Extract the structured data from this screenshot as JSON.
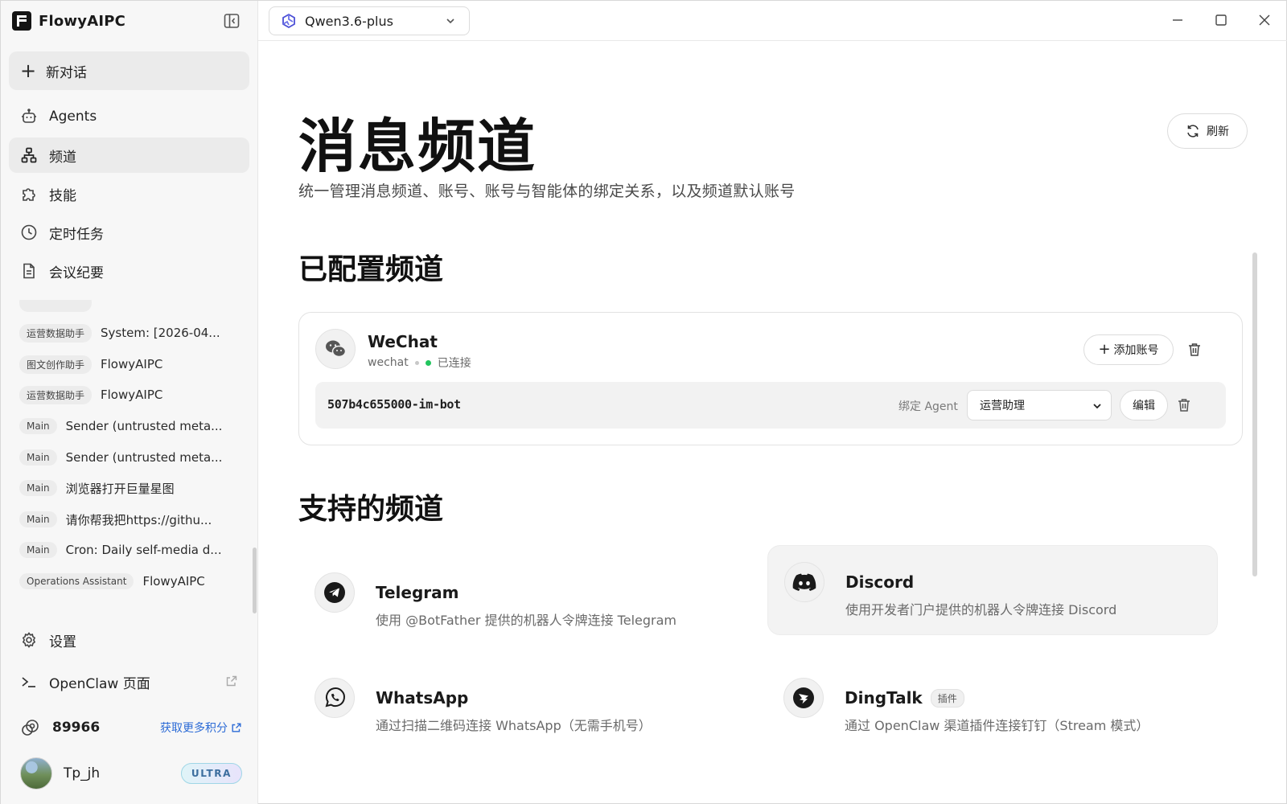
{
  "app": {
    "name": "FlowyAIPC",
    "model": "Qwen3.6-plus"
  },
  "sidebar": {
    "new_chat": "新对话",
    "nav": [
      {
        "label": "Agents",
        "icon": "robot-icon"
      },
      {
        "label": "频道",
        "icon": "channels-icon",
        "active": true
      },
      {
        "label": "技能",
        "icon": "puzzle-icon"
      },
      {
        "label": "定时任务",
        "icon": "clock-icon"
      },
      {
        "label": "会议纪要",
        "icon": "document-icon"
      }
    ],
    "history": [
      {
        "tag": "运营数据助手",
        "title": "System: [2026-04..."
      },
      {
        "tag": "图文创作助手",
        "title": "FlowyAIPC"
      },
      {
        "tag": "运营数据助手",
        "title": "FlowyAIPC"
      },
      {
        "tag": "Main",
        "title": "Sender (untrusted meta..."
      },
      {
        "tag": "Main",
        "title": "Sender (untrusted meta..."
      },
      {
        "tag": "Main",
        "title": "浏览器打开巨量星图"
      },
      {
        "tag": "Main",
        "title": "请你帮我把https://githu..."
      },
      {
        "tag": "Main",
        "title": "Cron: Daily self-media d..."
      },
      {
        "tag": "Operations Assistant",
        "title": "FlowyAIPC"
      }
    ],
    "settings": "设置",
    "openclaw": "OpenClaw 页面",
    "credits": {
      "value": "89966",
      "more": "获取更多积分"
    },
    "user": {
      "name": "Tp_jh",
      "badge": "ULTRA"
    }
  },
  "main": {
    "title": "消息频道",
    "subtitle": "统一管理消息频道、账号、账号与智能体的绑定关系，以及频道默认账号",
    "refresh": "刷新",
    "configured_title": "已配置频道",
    "configured": {
      "name": "WeChat",
      "type": "wechat",
      "status": "已连接",
      "status_color": "#22c55e",
      "add_account": "添加账号",
      "account": {
        "id": "507b4c655000-im-bot",
        "bind_label": "绑定 Agent",
        "agent": "运营助理",
        "edit": "编辑"
      }
    },
    "supported_title": "支持的频道",
    "supported": [
      {
        "name": "Telegram",
        "desc": "使用 @BotFather 提供的机器人令牌连接 Telegram",
        "icon": "telegram-icon"
      },
      {
        "name": "Discord",
        "desc": "使用开发者门户提供的机器人令牌连接 Discord",
        "icon": "discord-icon"
      },
      {
        "name": "WhatsApp",
        "desc": "通过扫描二维码连接 WhatsApp（无需手机号）",
        "icon": "whatsapp-icon"
      },
      {
        "name": "DingTalk",
        "tag": "插件",
        "desc": "通过 OpenClaw 渠道插件连接钉钉（Stream 模式）",
        "icon": "dingtalk-icon"
      }
    ]
  }
}
